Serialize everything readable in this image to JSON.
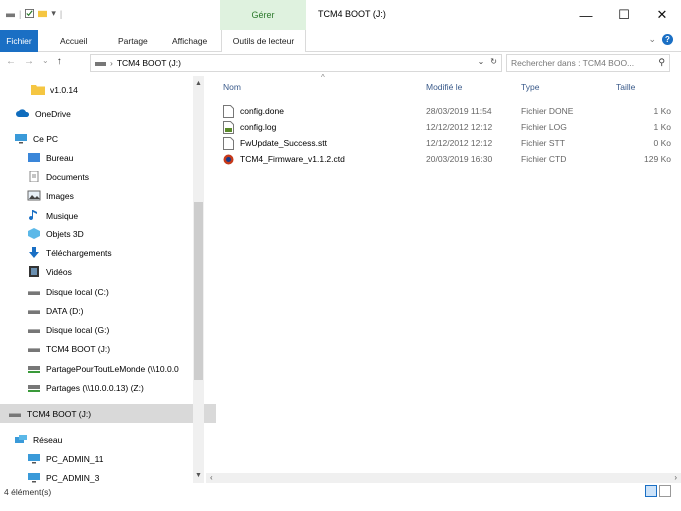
{
  "window": {
    "title": "TCM4 BOOT (J:)",
    "manage_tab": "Gérer",
    "controls": {
      "minimize": "—",
      "maximize": "☐",
      "close": "✕"
    }
  },
  "ribbon": {
    "tabs": [
      "Fichier",
      "Accueil",
      "Partage",
      "Affichage"
    ],
    "tools_tab": "Outils de lecteur"
  },
  "address": {
    "path": [
      "TCM4 BOOT (J:)"
    ],
    "search_placeholder": "Rechercher dans : TCM4 BOO..."
  },
  "nav_pane": {
    "items": [
      {
        "label": "v1.0.14",
        "icon": "folder-icon"
      },
      {
        "label": "OneDrive",
        "icon": "cloud-icon"
      },
      {
        "label": "Ce PC",
        "icon": "computer-icon"
      },
      {
        "label": "Bureau",
        "icon": "desktop-icon"
      },
      {
        "label": "Documents",
        "icon": "documents-icon"
      },
      {
        "label": "Images",
        "icon": "images-icon"
      },
      {
        "label": "Musique",
        "icon": "music-icon"
      },
      {
        "label": "Objets 3D",
        "icon": "objects3d-icon"
      },
      {
        "label": "Téléchargements",
        "icon": "downloads-icon"
      },
      {
        "label": "Vidéos",
        "icon": "videos-icon"
      },
      {
        "label": "Disque local (C:)",
        "icon": "drive-icon"
      },
      {
        "label": "DATA (D:)",
        "icon": "drive-icon"
      },
      {
        "label": "Disque local (G:)",
        "icon": "drive-icon"
      },
      {
        "label": "TCM4 BOOT (J:)",
        "icon": "drive-icon"
      },
      {
        "label": "PartagePourToutLeMonde (\\\\10.0.0",
        "icon": "network-drive-icon"
      },
      {
        "label": "Partages (\\\\10.0.0.13) (Z:)",
        "icon": "network-drive-icon"
      },
      {
        "label": "TCM4 BOOT (J:)",
        "icon": "drive-icon",
        "selected": true
      },
      {
        "label": "Réseau",
        "icon": "network-icon"
      },
      {
        "label": "PC_ADMIN_11",
        "icon": "computer-icon"
      },
      {
        "label": "PC_ADMIN_3",
        "icon": "computer-icon"
      }
    ]
  },
  "columns": {
    "name": "Nom",
    "modified": "Modifié le",
    "type": "Type",
    "size": "Taille"
  },
  "files": [
    {
      "name": "config.done",
      "modified": "28/03/2019 11:54",
      "type": "Fichier DONE",
      "size": "1 Ko",
      "icon": "file-icon"
    },
    {
      "name": "config.log",
      "modified": "12/12/2012 12:12",
      "type": "Fichier LOG",
      "size": "1 Ko",
      "icon": "log-file-icon"
    },
    {
      "name": "FwUpdate_Success.stt",
      "modified": "12/12/2012 12:12",
      "type": "Fichier STT",
      "size": "0 Ko",
      "icon": "file-icon"
    },
    {
      "name": "TCM4_Firmware_v1.1.2.ctd",
      "modified": "20/03/2019 16:30",
      "type": "Fichier CTD",
      "size": "129 Ko",
      "icon": "firmware-file-icon"
    }
  ],
  "status": {
    "count": "4 élément(s)"
  },
  "colors": {
    "accent": "#1a6fc4",
    "manage_bg": "#dff2df",
    "selection": "#d9d9d9"
  }
}
